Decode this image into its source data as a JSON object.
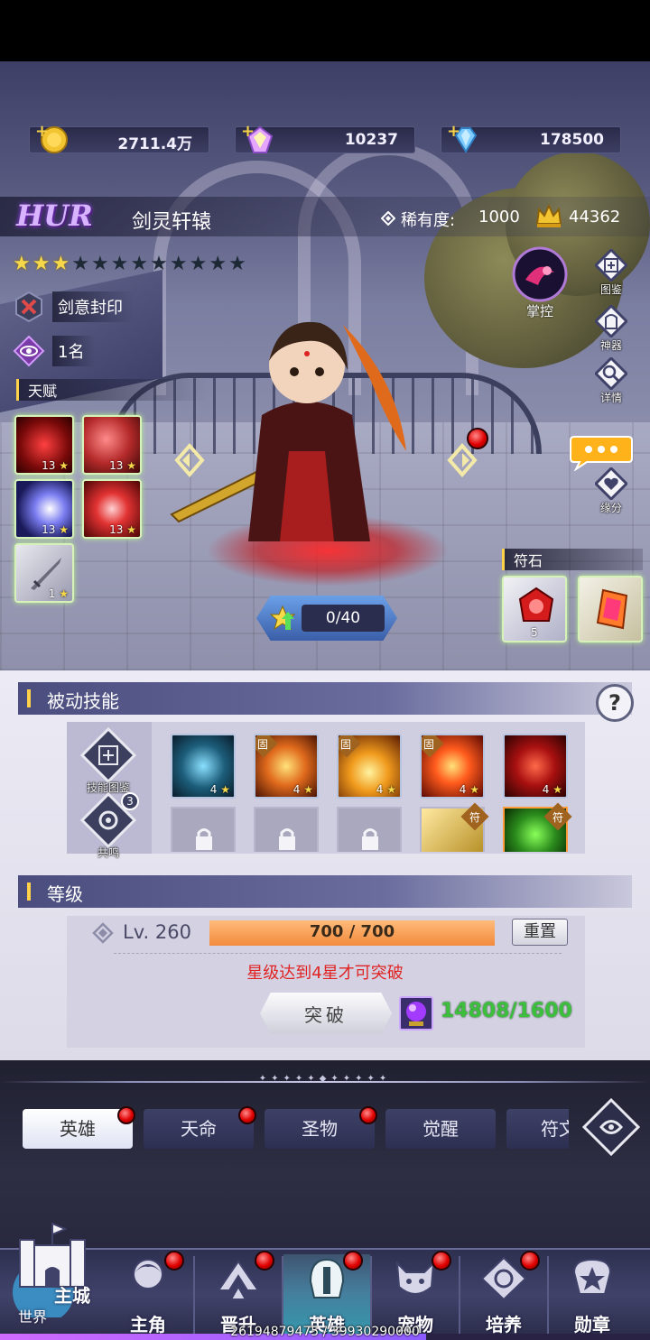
{
  "resources": [
    {
      "name": "gold",
      "value": "2711.4万"
    },
    {
      "name": "crystal",
      "value": "10237"
    },
    {
      "name": "diamond",
      "value": "178500"
    }
  ],
  "hero": {
    "grade": "HUR",
    "name": "剑灵轩辕",
    "rarity_label": "稀有度:",
    "rarity_value": "1000",
    "power": "44362",
    "stars_filled": 3,
    "stars_total": 12,
    "faction": "剑意封印",
    "rank": "1名",
    "talent_label": "天赋",
    "talents": [
      {
        "level": "13"
      },
      {
        "level": "13"
      },
      {
        "level": "13"
      },
      {
        "level": "13"
      },
      {
        "level": "1"
      }
    ],
    "star_progress": "0/40",
    "rune_label": "符石",
    "runes": [
      {
        "level": "5"
      },
      {
        "level": ""
      }
    ]
  },
  "side_buttons": {
    "control": "掌控",
    "codex": "图鉴",
    "artifact": "神器",
    "details": "详情",
    "fate": "缘分"
  },
  "passive": {
    "title": "被动技能",
    "help": "?",
    "codex_btn": "技能图鉴",
    "resonance_btn": "共鸣",
    "resonance_count": "3",
    "skills": [
      {
        "level": "4",
        "tag": ""
      },
      {
        "level": "4",
        "tag": "固"
      },
      {
        "level": "4",
        "tag": "固"
      },
      {
        "level": "4",
        "tag": "固"
      },
      {
        "level": "4",
        "tag": ""
      }
    ],
    "rune_tag": "符"
  },
  "level": {
    "title": "等级",
    "level_text": "Lv. 260",
    "xp_text": "700 / 700",
    "xp_fraction": 1.0,
    "reset": "重置",
    "warning": "星级达到4星才可突破",
    "break_btn": "突破",
    "cost": "14808/1600"
  },
  "subtabs": [
    "英雄",
    "天命",
    "圣物",
    "觉醒",
    "符文"
  ],
  "nav": {
    "city": "主城",
    "world": "世界",
    "items": [
      "主角",
      "晋升",
      "英雄",
      "宠物",
      "培养",
      "勋章"
    ],
    "active": "英雄"
  },
  "footer": {
    "exp": "26194879475 / 39930290000",
    "exp_fraction": 0.656
  }
}
